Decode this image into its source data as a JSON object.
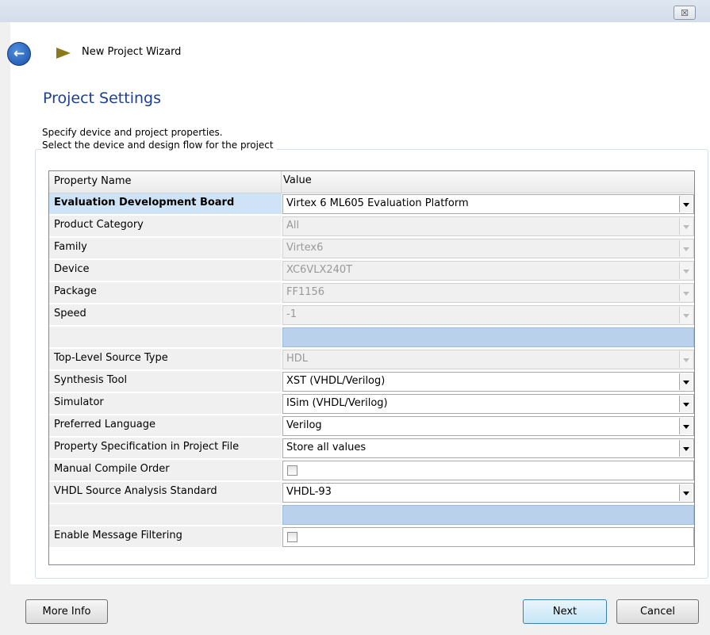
{
  "window": {
    "close_label": "☒",
    "wizard_title": "New Project Wizard"
  },
  "page": {
    "title": "Project Settings",
    "description": "Specify device and project properties.",
    "group_label": "Select the device and design flow for the project"
  },
  "table": {
    "headers": [
      "Property Name",
      "Value"
    ],
    "rows": [
      {
        "name": "Evaluation Development Board",
        "value": "Virtex 6 ML605 Evaluation Platform",
        "kind": "combo",
        "enabled": true,
        "selected": true
      },
      {
        "name": "Product Category",
        "value": "All",
        "kind": "combo",
        "enabled": false
      },
      {
        "name": "Family",
        "value": "Virtex6",
        "kind": "combo",
        "enabled": false
      },
      {
        "name": "Device",
        "value": "XC6VLX240T",
        "kind": "combo",
        "enabled": false
      },
      {
        "name": "Package",
        "value": "FF1156",
        "kind": "combo",
        "enabled": false
      },
      {
        "name": "Speed",
        "value": "-1",
        "kind": "combo",
        "enabled": false
      },
      {
        "name": "",
        "value": "",
        "kind": "blank"
      },
      {
        "name": "Top-Level Source Type",
        "value": "HDL",
        "kind": "combo",
        "enabled": false
      },
      {
        "name": "Synthesis Tool",
        "value": "XST (VHDL/Verilog)",
        "kind": "combo",
        "enabled": true
      },
      {
        "name": "Simulator",
        "value": "ISim (VHDL/Verilog)",
        "kind": "combo",
        "enabled": true
      },
      {
        "name": "Preferred Language",
        "value": "Verilog",
        "kind": "combo",
        "enabled": true
      },
      {
        "name": "Property Specification in Project File",
        "value": "Store all values",
        "kind": "combo",
        "enabled": true
      },
      {
        "name": "Manual Compile Order",
        "value": "",
        "kind": "checkbox",
        "checked": false
      },
      {
        "name": "VHDL Source Analysis Standard",
        "value": "VHDL-93",
        "kind": "combo",
        "enabled": true
      },
      {
        "name": "",
        "value": "",
        "kind": "blank"
      },
      {
        "name": "Enable Message Filtering",
        "value": "",
        "kind": "checkbox",
        "checked": false
      }
    ]
  },
  "buttons": {
    "more_info": "More Info",
    "next": "Next",
    "cancel": "Cancel"
  },
  "colors": {
    "title_blue": "#1d3f8f",
    "blank_row": "#b9d1ea",
    "selected_name": "#cfe3f7"
  }
}
